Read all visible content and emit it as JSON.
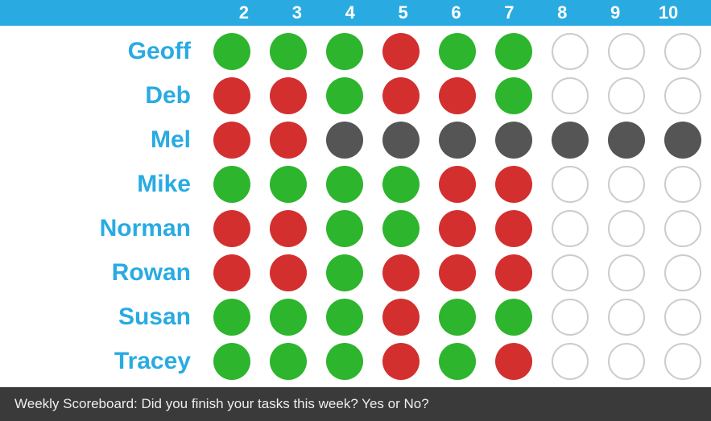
{
  "header": {
    "columns": [
      "2",
      "3",
      "4",
      "5",
      "6",
      "7",
      "8",
      "9",
      "10"
    ]
  },
  "rows": [
    {
      "name": "Geoff",
      "dots": [
        "green",
        "green",
        "green",
        "red",
        "green",
        "green",
        "empty",
        "empty",
        "empty"
      ]
    },
    {
      "name": "Deb",
      "dots": [
        "red",
        "red",
        "green",
        "red",
        "red",
        "green",
        "empty",
        "empty",
        "empty"
      ]
    },
    {
      "name": "Mel",
      "dots": [
        "red",
        "red",
        "gray",
        "gray",
        "gray",
        "gray",
        "gray",
        "gray",
        "gray"
      ]
    },
    {
      "name": "Mike",
      "dots": [
        "green",
        "green",
        "green",
        "green",
        "red",
        "red",
        "empty",
        "empty",
        "empty"
      ]
    },
    {
      "name": "Norman",
      "dots": [
        "red",
        "red",
        "green",
        "green",
        "red",
        "red",
        "empty",
        "empty",
        "empty"
      ]
    },
    {
      "name": "Rowan",
      "dots": [
        "red",
        "red",
        "green",
        "red",
        "red",
        "red",
        "empty",
        "empty",
        "empty"
      ]
    },
    {
      "name": "Susan",
      "dots": [
        "green",
        "green",
        "green",
        "red",
        "green",
        "green",
        "empty",
        "empty",
        "empty"
      ]
    },
    {
      "name": "Tracey",
      "dots": [
        "green",
        "green",
        "green",
        "red",
        "green",
        "red",
        "empty",
        "empty",
        "empty"
      ]
    }
  ],
  "footer": {
    "text": "Weekly Scoreboard: Did you finish your tasks this week? Yes or No?"
  }
}
